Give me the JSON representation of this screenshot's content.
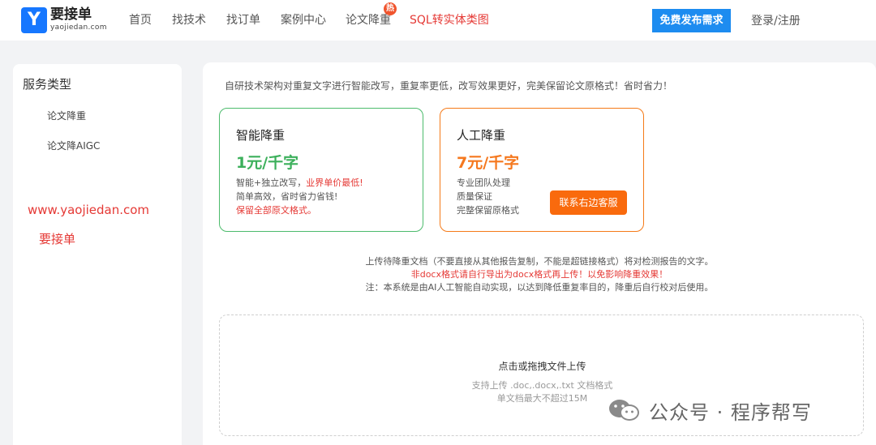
{
  "header": {
    "logo_letter": "Y",
    "brand_name": "要接单",
    "brand_domain": "yaojiedan.com",
    "nav": [
      {
        "label": "首页"
      },
      {
        "label": "找技术"
      },
      {
        "label": "找订单"
      },
      {
        "label": "案例中心"
      },
      {
        "label": "论文降重",
        "badge": "热"
      },
      {
        "label": "SQL转实体类图"
      }
    ],
    "publish_label": "免费发布需求",
    "login_label": "登录/注册"
  },
  "sidebar": {
    "title": "服务类型",
    "items": [
      {
        "label": "论文降重"
      },
      {
        "label": "论文降AIGC"
      }
    ],
    "watermark_url": "www.yaojiedan.com",
    "watermark_name": "要接单"
  },
  "main": {
    "intro": "自研技术架构对重复文字进行智能改写，重复率更低，改写效果更好，完美保留论文原格式！省时省力！",
    "smart_card": {
      "title": "智能降重",
      "price": "1元/千字",
      "line1_a": "智能+独立改写，",
      "line1_b": "业界单价最低!",
      "line2": "简单高效，省时省力省钱!",
      "line3": "保留全部原文格式。"
    },
    "manual_card": {
      "title": "人工降重",
      "price": "7元/千字",
      "line1": "专业团队处理",
      "line2": "质量保证",
      "line3": "完整保留原格式",
      "contact_label": "联系右边客服"
    },
    "notice1": "上传待降重文档（不要直接从其他报告复制，不能是超链接格式）将对检测报告的文字。",
    "notice2": "非docx格式请自行导出为docx格式再上传！以免影响降重效果！",
    "notice3": "注：本系统是由AI人工智能自动实现，以达到降低重复率目的，降重后自行校对后使用。",
    "upload": {
      "title": "点击或拖拽文件上传",
      "formats": "支持上传 .doc,.docx,.txt 文档格式",
      "limit": "单文档最大不超过15M"
    }
  },
  "watermark": {
    "text": "公众号 · 程序帮写"
  },
  "colors": {
    "primary_blue": "#1d8cf0",
    "smart_green": "#3cb05b",
    "manual_orange": "#f5781e",
    "alert_red": "#e53935"
  }
}
